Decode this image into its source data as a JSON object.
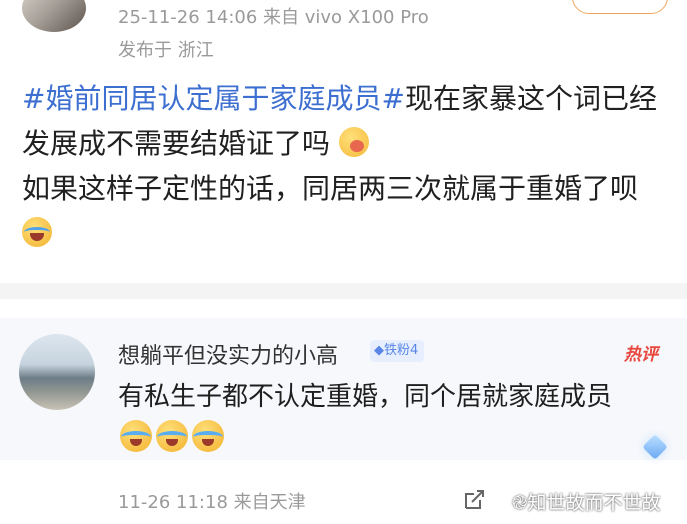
{
  "post": {
    "meta_time_device": "25-11-26 14:06  来自 vivo X100 Pro",
    "location": "发布于 浙江",
    "hashtag": "#婚前同居认定属于家庭成员#",
    "text_part1": "现在家暴这个词已经发展成不需要结婚证了吗",
    "emoji1": "yum-face-emoji",
    "text_part2": "如果这样子定性的话，同居两三次就属于重婚了呗",
    "emoji2": "laugh-cry-emoji"
  },
  "comment": {
    "name": "想躺平但没实力的小高",
    "badge": "铁粉4",
    "hot_label": "热评",
    "text": "有私生子都不认定重婚，同个居就家庭成员",
    "emojis": [
      "cry-emoji",
      "cry-emoji",
      "cry-emoji"
    ],
    "meta": "11-26 11:18  来自天津"
  },
  "watermark": "知世故而不世故",
  "colors": {
    "hashtag": "#3d6fd1",
    "hot": "#e8473e",
    "badge": "#5a86e8"
  }
}
